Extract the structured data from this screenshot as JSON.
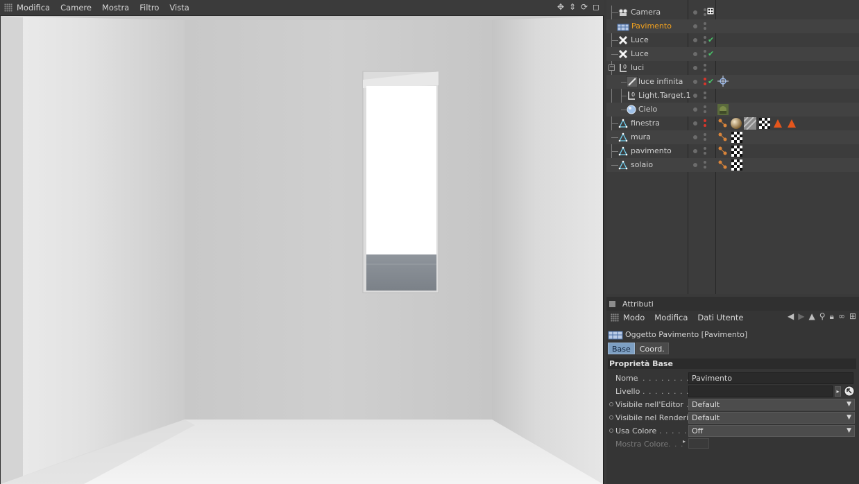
{
  "viewport": {
    "menu": [
      "Modifica",
      "Camere",
      "Mostra",
      "Filtro",
      "Vista"
    ]
  },
  "objects": [
    {
      "name": "Camera",
      "icon": "camera-icon",
      "active": false
    },
    {
      "name": "Pavimento",
      "icon": "floor-icon",
      "active": true
    },
    {
      "name": "Luce",
      "icon": "light-icon",
      "active": false,
      "check": true
    },
    {
      "name": "Luce",
      "icon": "light-icon",
      "active": false,
      "check": true
    },
    {
      "name": "luci",
      "icon": "null-icon",
      "active": false
    },
    {
      "name": "luce infinita",
      "icon": "infinite-light-icon",
      "active": false,
      "check": true
    },
    {
      "name": "Light.Target.1",
      "icon": "null-icon",
      "active": false
    },
    {
      "name": "Cielo",
      "icon": "sky-icon",
      "active": false
    },
    {
      "name": "finestra",
      "icon": "polygon-object-icon",
      "active": false
    },
    {
      "name": "mura",
      "icon": "polygon-object-icon",
      "active": false
    },
    {
      "name": "pavimento",
      "icon": "polygon-object-icon",
      "active": false
    },
    {
      "name": "solaio",
      "icon": "polygon-object-icon",
      "active": false
    }
  ],
  "attributes": {
    "panel_title": "Attributi",
    "menu": [
      "Modo",
      "Modifica",
      "Dati Utente"
    ],
    "object_title": "Oggetto Pavimento [Pavimento]",
    "tabs": [
      "Base",
      "Coord."
    ],
    "section": "Proprietà Base",
    "props": {
      "nome_label": "Nome",
      "nome_value": "Pavimento",
      "livello_label": "Livello",
      "vis_editor_label": "Visibile nell'Editor",
      "vis_editor_value": "Default",
      "vis_render_label": "Visibile nel Rendering",
      "vis_render_value": "Default",
      "usa_colore_label": "Usa Colore",
      "usa_colore_value": "Off",
      "mostra_colore_label": "Mostra Colore"
    }
  },
  "colors": {
    "active_object": "#f3a21e",
    "active_tab": "#7d9fc2",
    "check": "#49c46a"
  }
}
